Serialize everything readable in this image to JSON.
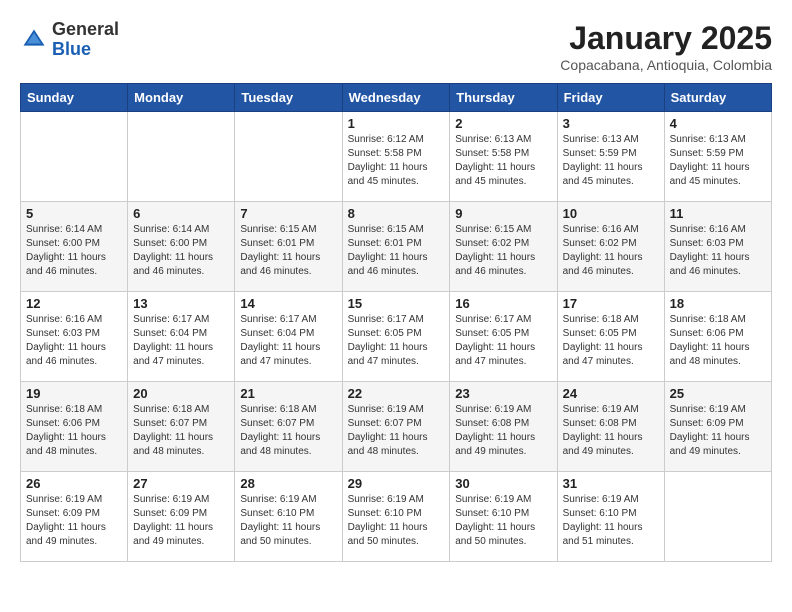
{
  "logo": {
    "general": "General",
    "blue": "Blue"
  },
  "title": "January 2025",
  "subtitle": "Copacabana, Antioquia, Colombia",
  "days_of_week": [
    "Sunday",
    "Monday",
    "Tuesday",
    "Wednesday",
    "Thursday",
    "Friday",
    "Saturday"
  ],
  "weeks": [
    [
      {
        "day": "",
        "info": ""
      },
      {
        "day": "",
        "info": ""
      },
      {
        "day": "",
        "info": ""
      },
      {
        "day": "1",
        "info": "Sunrise: 6:12 AM\nSunset: 5:58 PM\nDaylight: 11 hours and 45 minutes."
      },
      {
        "day": "2",
        "info": "Sunrise: 6:13 AM\nSunset: 5:58 PM\nDaylight: 11 hours and 45 minutes."
      },
      {
        "day": "3",
        "info": "Sunrise: 6:13 AM\nSunset: 5:59 PM\nDaylight: 11 hours and 45 minutes."
      },
      {
        "day": "4",
        "info": "Sunrise: 6:13 AM\nSunset: 5:59 PM\nDaylight: 11 hours and 45 minutes."
      }
    ],
    [
      {
        "day": "5",
        "info": "Sunrise: 6:14 AM\nSunset: 6:00 PM\nDaylight: 11 hours and 46 minutes."
      },
      {
        "day": "6",
        "info": "Sunrise: 6:14 AM\nSunset: 6:00 PM\nDaylight: 11 hours and 46 minutes."
      },
      {
        "day": "7",
        "info": "Sunrise: 6:15 AM\nSunset: 6:01 PM\nDaylight: 11 hours and 46 minutes."
      },
      {
        "day": "8",
        "info": "Sunrise: 6:15 AM\nSunset: 6:01 PM\nDaylight: 11 hours and 46 minutes."
      },
      {
        "day": "9",
        "info": "Sunrise: 6:15 AM\nSunset: 6:02 PM\nDaylight: 11 hours and 46 minutes."
      },
      {
        "day": "10",
        "info": "Sunrise: 6:16 AM\nSunset: 6:02 PM\nDaylight: 11 hours and 46 minutes."
      },
      {
        "day": "11",
        "info": "Sunrise: 6:16 AM\nSunset: 6:03 PM\nDaylight: 11 hours and 46 minutes."
      }
    ],
    [
      {
        "day": "12",
        "info": "Sunrise: 6:16 AM\nSunset: 6:03 PM\nDaylight: 11 hours and 46 minutes."
      },
      {
        "day": "13",
        "info": "Sunrise: 6:17 AM\nSunset: 6:04 PM\nDaylight: 11 hours and 47 minutes."
      },
      {
        "day": "14",
        "info": "Sunrise: 6:17 AM\nSunset: 6:04 PM\nDaylight: 11 hours and 47 minutes."
      },
      {
        "day": "15",
        "info": "Sunrise: 6:17 AM\nSunset: 6:05 PM\nDaylight: 11 hours and 47 minutes."
      },
      {
        "day": "16",
        "info": "Sunrise: 6:17 AM\nSunset: 6:05 PM\nDaylight: 11 hours and 47 minutes."
      },
      {
        "day": "17",
        "info": "Sunrise: 6:18 AM\nSunset: 6:05 PM\nDaylight: 11 hours and 47 minutes."
      },
      {
        "day": "18",
        "info": "Sunrise: 6:18 AM\nSunset: 6:06 PM\nDaylight: 11 hours and 48 minutes."
      }
    ],
    [
      {
        "day": "19",
        "info": "Sunrise: 6:18 AM\nSunset: 6:06 PM\nDaylight: 11 hours and 48 minutes."
      },
      {
        "day": "20",
        "info": "Sunrise: 6:18 AM\nSunset: 6:07 PM\nDaylight: 11 hours and 48 minutes."
      },
      {
        "day": "21",
        "info": "Sunrise: 6:18 AM\nSunset: 6:07 PM\nDaylight: 11 hours and 48 minutes."
      },
      {
        "day": "22",
        "info": "Sunrise: 6:19 AM\nSunset: 6:07 PM\nDaylight: 11 hours and 48 minutes."
      },
      {
        "day": "23",
        "info": "Sunrise: 6:19 AM\nSunset: 6:08 PM\nDaylight: 11 hours and 49 minutes."
      },
      {
        "day": "24",
        "info": "Sunrise: 6:19 AM\nSunset: 6:08 PM\nDaylight: 11 hours and 49 minutes."
      },
      {
        "day": "25",
        "info": "Sunrise: 6:19 AM\nSunset: 6:09 PM\nDaylight: 11 hours and 49 minutes."
      }
    ],
    [
      {
        "day": "26",
        "info": "Sunrise: 6:19 AM\nSunset: 6:09 PM\nDaylight: 11 hours and 49 minutes."
      },
      {
        "day": "27",
        "info": "Sunrise: 6:19 AM\nSunset: 6:09 PM\nDaylight: 11 hours and 49 minutes."
      },
      {
        "day": "28",
        "info": "Sunrise: 6:19 AM\nSunset: 6:10 PM\nDaylight: 11 hours and 50 minutes."
      },
      {
        "day": "29",
        "info": "Sunrise: 6:19 AM\nSunset: 6:10 PM\nDaylight: 11 hours and 50 minutes."
      },
      {
        "day": "30",
        "info": "Sunrise: 6:19 AM\nSunset: 6:10 PM\nDaylight: 11 hours and 50 minutes."
      },
      {
        "day": "31",
        "info": "Sunrise: 6:19 AM\nSunset: 6:10 PM\nDaylight: 11 hours and 51 minutes."
      },
      {
        "day": "",
        "info": ""
      }
    ]
  ]
}
